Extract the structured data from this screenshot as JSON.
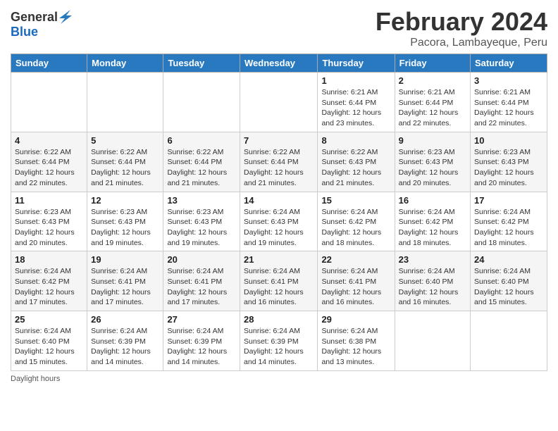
{
  "logo": {
    "general": "General",
    "blue": "Blue"
  },
  "title": "February 2024",
  "location": "Pacora, Lambayeque, Peru",
  "days_of_week": [
    "Sunday",
    "Monday",
    "Tuesday",
    "Wednesday",
    "Thursday",
    "Friday",
    "Saturday"
  ],
  "weeks": [
    [
      {
        "day": "",
        "info": ""
      },
      {
        "day": "",
        "info": ""
      },
      {
        "day": "",
        "info": ""
      },
      {
        "day": "",
        "info": ""
      },
      {
        "day": "1",
        "info": "Sunrise: 6:21 AM\nSunset: 6:44 PM\nDaylight: 12 hours and 23 minutes."
      },
      {
        "day": "2",
        "info": "Sunrise: 6:21 AM\nSunset: 6:44 PM\nDaylight: 12 hours and 22 minutes."
      },
      {
        "day": "3",
        "info": "Sunrise: 6:21 AM\nSunset: 6:44 PM\nDaylight: 12 hours and 22 minutes."
      }
    ],
    [
      {
        "day": "4",
        "info": "Sunrise: 6:22 AM\nSunset: 6:44 PM\nDaylight: 12 hours and 22 minutes."
      },
      {
        "day": "5",
        "info": "Sunrise: 6:22 AM\nSunset: 6:44 PM\nDaylight: 12 hours and 21 minutes."
      },
      {
        "day": "6",
        "info": "Sunrise: 6:22 AM\nSunset: 6:44 PM\nDaylight: 12 hours and 21 minutes."
      },
      {
        "day": "7",
        "info": "Sunrise: 6:22 AM\nSunset: 6:44 PM\nDaylight: 12 hours and 21 minutes."
      },
      {
        "day": "8",
        "info": "Sunrise: 6:22 AM\nSunset: 6:43 PM\nDaylight: 12 hours and 21 minutes."
      },
      {
        "day": "9",
        "info": "Sunrise: 6:23 AM\nSunset: 6:43 PM\nDaylight: 12 hours and 20 minutes."
      },
      {
        "day": "10",
        "info": "Sunrise: 6:23 AM\nSunset: 6:43 PM\nDaylight: 12 hours and 20 minutes."
      }
    ],
    [
      {
        "day": "11",
        "info": "Sunrise: 6:23 AM\nSunset: 6:43 PM\nDaylight: 12 hours and 20 minutes."
      },
      {
        "day": "12",
        "info": "Sunrise: 6:23 AM\nSunset: 6:43 PM\nDaylight: 12 hours and 19 minutes."
      },
      {
        "day": "13",
        "info": "Sunrise: 6:23 AM\nSunset: 6:43 PM\nDaylight: 12 hours and 19 minutes."
      },
      {
        "day": "14",
        "info": "Sunrise: 6:24 AM\nSunset: 6:43 PM\nDaylight: 12 hours and 19 minutes."
      },
      {
        "day": "15",
        "info": "Sunrise: 6:24 AM\nSunset: 6:42 PM\nDaylight: 12 hours and 18 minutes."
      },
      {
        "day": "16",
        "info": "Sunrise: 6:24 AM\nSunset: 6:42 PM\nDaylight: 12 hours and 18 minutes."
      },
      {
        "day": "17",
        "info": "Sunrise: 6:24 AM\nSunset: 6:42 PM\nDaylight: 12 hours and 18 minutes."
      }
    ],
    [
      {
        "day": "18",
        "info": "Sunrise: 6:24 AM\nSunset: 6:42 PM\nDaylight: 12 hours and 17 minutes."
      },
      {
        "day": "19",
        "info": "Sunrise: 6:24 AM\nSunset: 6:41 PM\nDaylight: 12 hours and 17 minutes."
      },
      {
        "day": "20",
        "info": "Sunrise: 6:24 AM\nSunset: 6:41 PM\nDaylight: 12 hours and 17 minutes."
      },
      {
        "day": "21",
        "info": "Sunrise: 6:24 AM\nSunset: 6:41 PM\nDaylight: 12 hours and 16 minutes."
      },
      {
        "day": "22",
        "info": "Sunrise: 6:24 AM\nSunset: 6:41 PM\nDaylight: 12 hours and 16 minutes."
      },
      {
        "day": "23",
        "info": "Sunrise: 6:24 AM\nSunset: 6:40 PM\nDaylight: 12 hours and 16 minutes."
      },
      {
        "day": "24",
        "info": "Sunrise: 6:24 AM\nSunset: 6:40 PM\nDaylight: 12 hours and 15 minutes."
      }
    ],
    [
      {
        "day": "25",
        "info": "Sunrise: 6:24 AM\nSunset: 6:40 PM\nDaylight: 12 hours and 15 minutes."
      },
      {
        "day": "26",
        "info": "Sunrise: 6:24 AM\nSunset: 6:39 PM\nDaylight: 12 hours and 14 minutes."
      },
      {
        "day": "27",
        "info": "Sunrise: 6:24 AM\nSunset: 6:39 PM\nDaylight: 12 hours and 14 minutes."
      },
      {
        "day": "28",
        "info": "Sunrise: 6:24 AM\nSunset: 6:39 PM\nDaylight: 12 hours and 14 minutes."
      },
      {
        "day": "29",
        "info": "Sunrise: 6:24 AM\nSunset: 6:38 PM\nDaylight: 12 hours and 13 minutes."
      },
      {
        "day": "",
        "info": ""
      },
      {
        "day": "",
        "info": ""
      }
    ]
  ],
  "footer": "Daylight hours"
}
